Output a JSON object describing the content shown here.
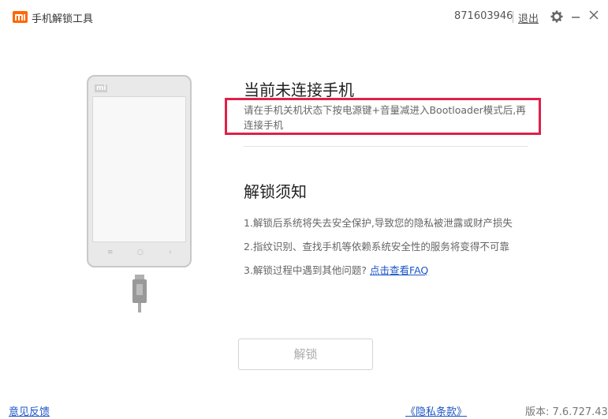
{
  "titlebar": {
    "logo_text": "mi",
    "app_title": "手机解锁工具",
    "user_id": "871603946",
    "logout_label": "退出",
    "icons": [
      "gear-icon",
      "minimize-icon",
      "close-icon"
    ]
  },
  "phone": {
    "logo_text": "mi",
    "buttons": [
      "≡",
      "○",
      "‹"
    ]
  },
  "status": {
    "title": "当前未连接手机",
    "hint": "请在手机关机状态下按电源键+音量减进入Bootloader模式后,再连接手机"
  },
  "notice": {
    "title": "解锁须知",
    "items": [
      "1.解锁后系统将失去安全保护,导致您的隐私被泄露或财产损失",
      "2.指纹识别、查找手机等依赖系统安全性的服务将变得不可靠",
      "3.解锁过程中遇到其他问题?"
    ],
    "faq_link": "点击查看FAQ"
  },
  "unlock_button": "解锁",
  "footer": {
    "feedback": "意见反馈",
    "privacy": "《隐私条款》",
    "version": "版本: 7.6.727.43"
  },
  "colors": {
    "accent_orange": "#ff6700",
    "highlight_red": "#e0204a",
    "link_blue": "#1d55c7"
  }
}
